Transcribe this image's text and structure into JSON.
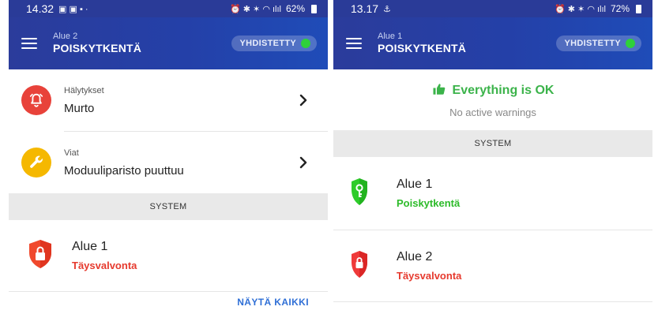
{
  "left_screen": {
    "status_bar": {
      "time": "14.32",
      "battery": "62%"
    },
    "app_bar": {
      "subtitle": "Alue 2",
      "title": "POISKYTKENTÄ",
      "connection": "YHDISTETTY"
    },
    "notifications": [
      {
        "label": "Hälytykset",
        "value": "Murto",
        "icon": "alarm-bell-icon",
        "color": "#e8423a"
      },
      {
        "label": "Viat",
        "value": "Moduuliparisto puuttuu",
        "icon": "wrench-icon",
        "color": "#f5b800"
      }
    ],
    "section_header": "SYSTEM",
    "areas": [
      {
        "name": "Alue 1",
        "status": "Täysvalvonta",
        "icon": "lock-shield-icon",
        "status_color": "#e63a2e"
      }
    ],
    "show_all": "NÄYTÄ KAIKKI"
  },
  "right_screen": {
    "status_bar": {
      "time": "13.17",
      "battery": "72%"
    },
    "app_bar": {
      "subtitle": "Alue 1",
      "title": "POISKYTKENTÄ",
      "connection": "YHDISTETTY"
    },
    "ok_title": "Everything is OK",
    "ok_subtitle": "No active warnings",
    "section_header": "SYSTEM",
    "areas": [
      {
        "name": "Alue 1",
        "status": "Poiskytkentä",
        "icon": "key-shield-icon",
        "status_color": "#2dbb2a"
      },
      {
        "name": "Alue 2",
        "status": "Täysvalvonta",
        "icon": "lock-shield-icon",
        "status_color": "#e63a2e"
      }
    ]
  },
  "colors": {
    "header_blue": "#2a3b98",
    "connected_green": "#2ed13a",
    "ok_green": "#3bb34a",
    "link_blue": "#2f6fd6"
  }
}
